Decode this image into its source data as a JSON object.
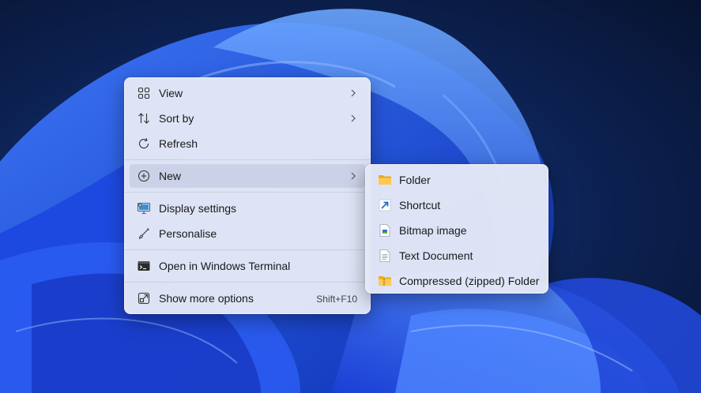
{
  "context_menu": {
    "items": [
      {
        "label": "View",
        "icon": "view-grid-icon"
      },
      {
        "label": "Sort by",
        "icon": "sort-icon"
      },
      {
        "label": "Refresh",
        "icon": "refresh-icon"
      },
      {
        "label": "New",
        "icon": "new-plus-icon"
      },
      {
        "label": "Display settings",
        "icon": "display-settings-icon"
      },
      {
        "label": "Personalise",
        "icon": "brush-icon"
      },
      {
        "label": "Open in Windows Terminal",
        "icon": "terminal-icon"
      },
      {
        "label": "Show more options",
        "icon": "show-more-icon",
        "shortcut": "Shift+F10"
      }
    ]
  },
  "new_submenu": {
    "items": [
      {
        "label": "Folder",
        "icon": "folder-icon"
      },
      {
        "label": "Shortcut",
        "icon": "shortcut-icon"
      },
      {
        "label": "Bitmap image",
        "icon": "bitmap-icon"
      },
      {
        "label": "Text Document",
        "icon": "text-document-icon"
      },
      {
        "label": "Compressed (zipped) Folder",
        "icon": "zip-folder-icon"
      }
    ]
  },
  "colors": {
    "wallpaper_background": "#0b1a3a",
    "wallpaper_bloom": "#2a5cf0",
    "menu_background": "#e4e8f6",
    "active_item": "#c8cee4"
  }
}
